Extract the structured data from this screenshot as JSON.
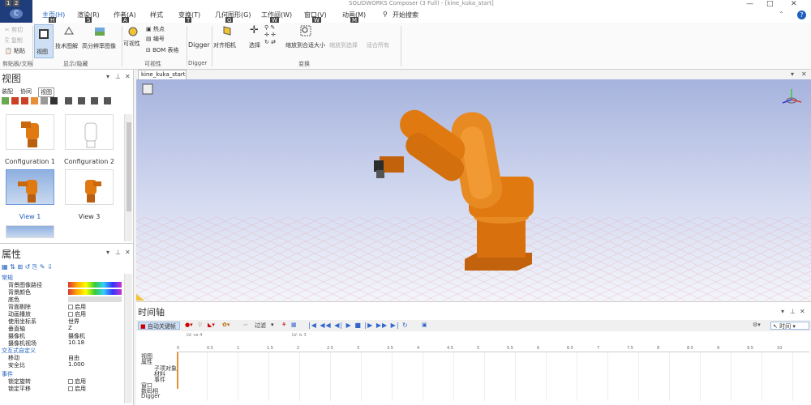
{
  "app": {
    "window_title": "SOLIDWORKS Composer (3 Full) - [kine_kuka_start]",
    "quick_access": [
      "1",
      "2"
    ],
    "window_controls": [
      "—",
      "□",
      "✕"
    ]
  },
  "menu": {
    "tabs": [
      {
        "label": "主页(H)",
        "key": "H",
        "active": true
      },
      {
        "label": "渲染(R)",
        "key": "R"
      },
      {
        "label": "作者(A)",
        "key": "A"
      },
      {
        "label": "样式",
        "key": ""
      },
      {
        "label": "变换(T)",
        "key": "T"
      },
      {
        "label": "几何图形(G)",
        "key": "G"
      },
      {
        "label": "工作间(W)",
        "key": "W"
      },
      {
        "label": "窗口(V)",
        "key": "V"
      },
      {
        "label": "动画(M)",
        "key": "M"
      },
      {
        "label": "开始搜索",
        "key": ""
      }
    ],
    "keytips": [
      "H",
      "S",
      "A",
      "T",
      "G",
      "W",
      "W",
      "M"
    ],
    "help": "?"
  },
  "ribbon": {
    "clipboard": {
      "cut": "剪切",
      "copy": "复制",
      "paste": "粘贴",
      "label": "剪贴板/文档"
    },
    "show_hide": {
      "view": "视图",
      "technical_illustration": "技术图解",
      "high_res": "高分辨率图像",
      "label": "显示/隐藏"
    },
    "visibility": {
      "visibility": "可视性",
      "hotspot": "热点",
      "notes": "编号",
      "bom": "BOM 表格",
      "label": "可视性"
    },
    "digger": {
      "digger": "Digger",
      "label": "Digger"
    },
    "transform": {
      "align_camera": "对齐相机",
      "select": "选择",
      "zoom_fit": "缩放到合适大小",
      "zoom_selection": "缩放到选择",
      "fit_all": "适合所有",
      "label": "变换"
    }
  },
  "views_panel": {
    "title": "视图",
    "tabs": [
      "装配",
      "协同",
      "视图"
    ],
    "active_tab": "视图",
    "thumbnails": [
      {
        "label": "Configuration 1",
        "style": "white",
        "selected": false
      },
      {
        "label": "Configuration 2",
        "style": "white",
        "selected": false
      },
      {
        "label": "View 1",
        "style": "blue",
        "selected": true
      },
      {
        "label": "View 3",
        "style": "white",
        "selected": false
      }
    ]
  },
  "properties_panel": {
    "title": "属性",
    "categories": [
      {
        "label": "常规",
        "rows": [
          {
            "name": "背景图像路径",
            "value": ""
          },
          {
            "name": "背景颜色",
            "value": ""
          },
          {
            "name": "底色",
            "value": ""
          },
          {
            "name": "背面剔除",
            "value": "启用",
            "checkbox": true
          },
          {
            "name": "动画播放",
            "value": "启用",
            "checkbox": true
          },
          {
            "name": "使用坐标系",
            "value": "世界"
          },
          {
            "name": "垂直轴",
            "value": "Z"
          },
          {
            "name": "摄像机",
            "value": "摄像机"
          },
          {
            "name": "摄像机视场",
            "value": "10.18"
          }
        ]
      },
      {
        "label": "交互式自定义",
        "rows": [
          {
            "name": "移动",
            "value": "自由"
          },
          {
            "name": "安全比",
            "value": "1.000"
          }
        ]
      },
      {
        "label": "事件",
        "rows": [
          {
            "name": "锁定旋转",
            "value": "启用",
            "checkbox": true
          },
          {
            "name": "锁定平移",
            "value": "启用",
            "checkbox": true
          }
        ]
      }
    ]
  },
  "document": {
    "tab": "kine_kuka_start"
  },
  "timeline": {
    "title": "时间轴",
    "auto_key": "自动关键帧",
    "filter": "过滤",
    "markers": [
      "LV: ve 4",
      "LV: iv 3"
    ],
    "track_labels": [
      "视图",
      "属性",
      "子项对象",
      "材料",
      "事件",
      "窗口",
      "数码相",
      "Digger"
    ],
    "ticks": [
      "0",
      "0.5",
      "1",
      "1.5",
      "2",
      "2.5",
      "3",
      "3.5",
      "4",
      "4.5",
      "5",
      "5.5",
      "6",
      "6.5",
      "7",
      "7.5",
      "8",
      "8.5",
      "9",
      "9.5",
      "10"
    ],
    "mode": "时间"
  },
  "colors": {
    "accent": "#1f5fbf",
    "app_button": "#1f3d7a",
    "robot": "#e07a10"
  }
}
